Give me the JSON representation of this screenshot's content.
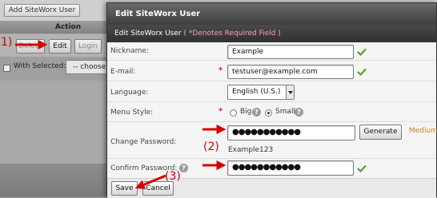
{
  "background": {
    "add_button": "Add SiteWorx User",
    "action_header": "Action",
    "delete_button": "Delete",
    "edit_button": "Edit",
    "login_button": "Login",
    "with_selected_label": "With Selected:",
    "choose_select": "-- choose"
  },
  "dialog": {
    "title": "Edit SiteWorx User",
    "form_header": "Edit SiteWorx User",
    "required_note": "( *Denotes Required Field )",
    "fields": {
      "nickname": {
        "label": "Nickname:",
        "value": "Example"
      },
      "email": {
        "label": "E-mail:",
        "value": "testuser@example.com"
      },
      "language": {
        "label": "Language:",
        "value": "English (U.S.)"
      },
      "menu_style": {
        "label": "Menu Style:",
        "option_big": "Big",
        "option_small": "Small",
        "selected": "Small"
      },
      "change_password": {
        "label": "Change Password:",
        "value": "●●●●●●●●●●●",
        "generate_button": "Generate",
        "strength": "Medium",
        "generated_text": "Example123"
      },
      "confirm_password": {
        "label": "Confirm Password:",
        "value": "●●●●●●●●●●●"
      }
    },
    "save_button": "Save",
    "cancel_button": "Cancel"
  },
  "annotations": {
    "step1": "1)",
    "step2": "(2)",
    "step3": "(3)",
    "color": "#d40000"
  }
}
